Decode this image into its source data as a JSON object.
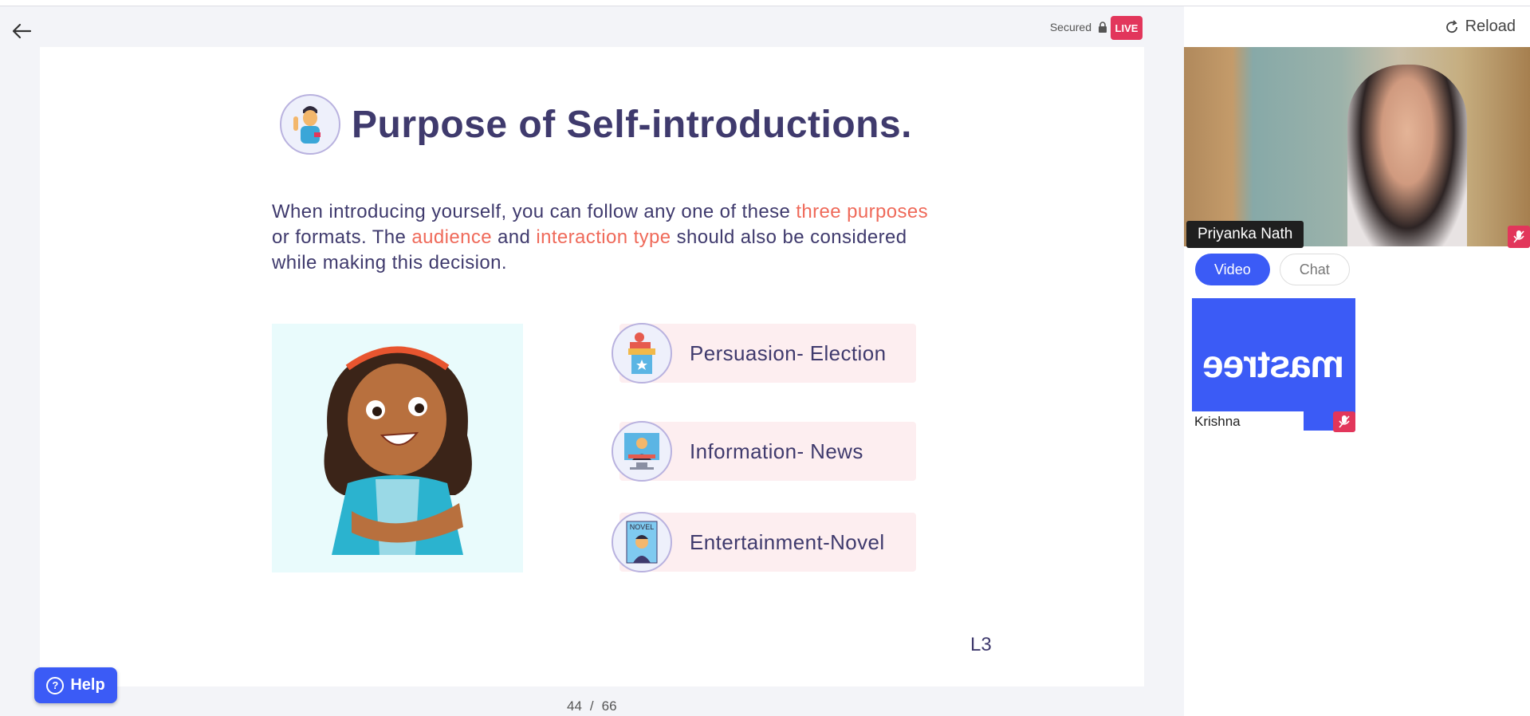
{
  "header": {
    "secured_label": "Secured",
    "live_badge": "LIVE"
  },
  "slide": {
    "title": "Purpose of Self-introductions.",
    "paragraph": {
      "p1": "When introducing yourself, you can follow any one of these ",
      "h1": "three purposes",
      "p2": " or formats. The ",
      "h2": "audience",
      "p3": " and ",
      "h3": "interaction type",
      "p4": " should also be considered while making this decision."
    },
    "cards": [
      {
        "label": "Persuasion- Election",
        "icon": "podium-icon"
      },
      {
        "label": "Information- News",
        "icon": "news-anchor-icon"
      },
      {
        "label": "Entertainment-Novel",
        "icon": "novel-icon",
        "icon_text": "NOVEL"
      }
    ],
    "code": "L3"
  },
  "pagination": {
    "current": "44",
    "separator": "/",
    "total": "66"
  },
  "help": {
    "label": "Help"
  },
  "sidebar": {
    "reload_label": "Reload",
    "main_participant": "Priyanka Nath",
    "tabs": [
      {
        "label": "Video",
        "active": true
      },
      {
        "label": "Chat",
        "active": false
      }
    ],
    "tiles": [
      {
        "name": "Krishna",
        "brand": "mastree"
      }
    ]
  },
  "colors": {
    "accent": "#3b5bf6",
    "title": "#3f3a6d",
    "highlight": "#ef6a5a",
    "live": "#e2365b",
    "card_bg": "#fdeef0"
  }
}
